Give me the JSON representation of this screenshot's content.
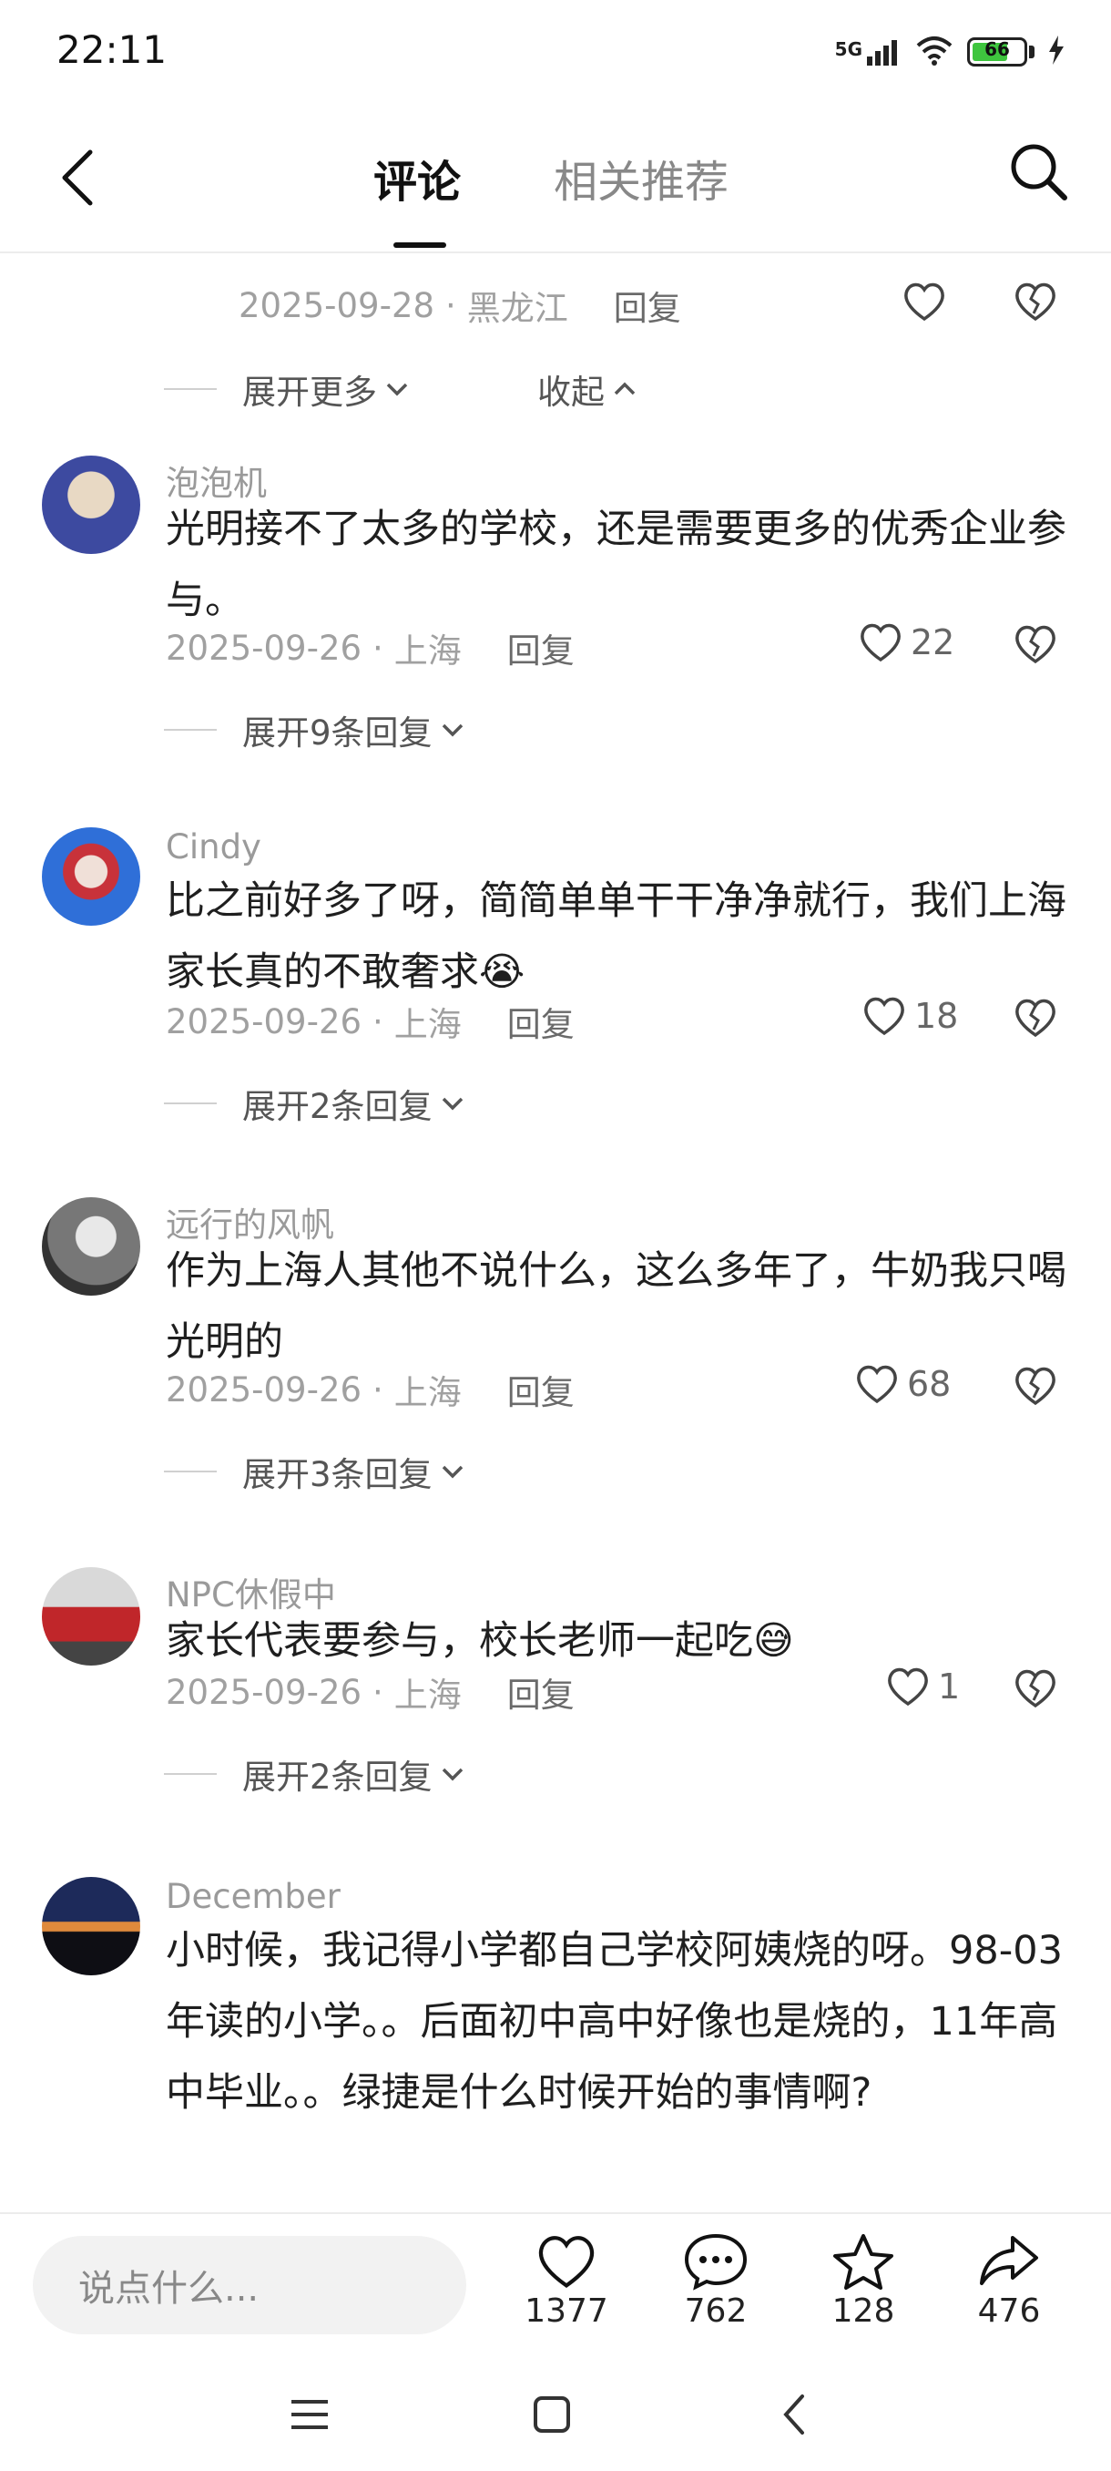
{
  "status_bar": {
    "time": "22:11",
    "network": "5G",
    "battery": "66"
  },
  "header": {
    "tabs": [
      "评论",
      "相关推荐"
    ],
    "active_tab": "评论"
  },
  "truncated_reply": {
    "date": "2025-09-28",
    "location": "黑龙江",
    "reply": "回复",
    "expand_more": "展开更多",
    "collapse": "收起"
  },
  "comments": [
    {
      "username": "泡泡机",
      "text": "光明接不了太多的学校，还是需要更多的优秀企业参与。",
      "date": "2025-09-26",
      "location": "上海",
      "reply": "回复",
      "likes": "22",
      "expand": "展开9条回复",
      "avatar_color": "#3d4aa0"
    },
    {
      "username": "Cindy",
      "text": "比之前好多了呀，简简单单干干净净就行，我们上海家长真的不敢奢求😭",
      "date": "2025-09-26",
      "location": "上海",
      "reply": "回复",
      "likes": "18",
      "expand": "展开2条回复",
      "avatar_color": "#2f6fd8"
    },
    {
      "username": "远行的风帆",
      "text": "作为上海人其他不说什么，这么多年了，牛奶我只喝光明的",
      "date": "2025-09-26",
      "location": "上海",
      "reply": "回复",
      "likes": "68",
      "expand": "展开3条回复",
      "avatar_color": "#555555"
    },
    {
      "username": "NPC休假中",
      "text": "家长代表要参与，校长老师一起吃😅",
      "date": "2025-09-26",
      "location": "上海",
      "reply": "回复",
      "likes": "1",
      "expand": "展开2条回复",
      "avatar_color": "#c0262a"
    },
    {
      "username": "December",
      "text": "小时候，我记得小学都自己学校阿姨烧的呀。98-03年读的小学。。后面初中高中好像也是烧的，11年高中毕业。。绿捷是什么时候开始的事情啊?",
      "avatar_color": "#1d2a5a"
    }
  ],
  "bottom_bar": {
    "input_placeholder": "说点什么...",
    "likes": "1377",
    "comments": "762",
    "favorites": "128",
    "shares": "476"
  }
}
